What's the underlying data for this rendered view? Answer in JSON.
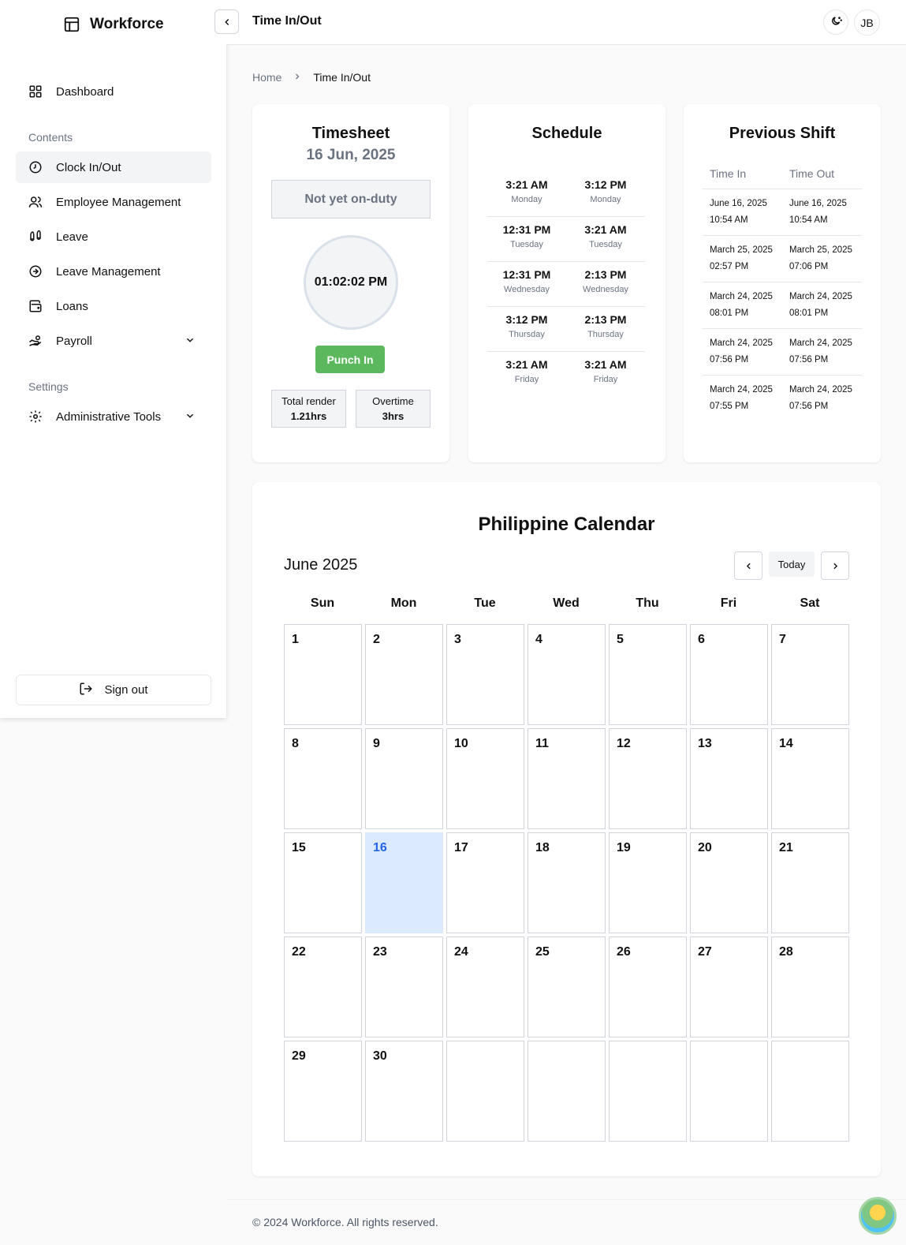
{
  "app": {
    "name": "Workforce"
  },
  "sidebar": {
    "sections": {
      "contents": "Contents",
      "settings": "Settings"
    },
    "items": [
      {
        "label": "Dashboard",
        "icon": "grid-icon"
      },
      {
        "label": "Clock In/Out",
        "icon": "clock-icon",
        "active": true
      },
      {
        "label": "Employee Management",
        "icon": "users-icon"
      },
      {
        "label": "Leave",
        "icon": "footprints-icon"
      },
      {
        "label": "Leave Management",
        "icon": "arrow-circle-icon"
      },
      {
        "label": "Loans",
        "icon": "wallet-icon"
      },
      {
        "label": "Payroll",
        "icon": "hand-coins-icon",
        "expandable": true
      },
      {
        "label": "Administrative Tools",
        "icon": "gear-icon",
        "expandable": true
      }
    ],
    "signout": "Sign out"
  },
  "header": {
    "title": "Time In/Out",
    "avatar": "JB"
  },
  "breadcrumb": {
    "home": "Home",
    "current": "Time In/Out"
  },
  "timesheet": {
    "title": "Timesheet",
    "date": "16 Jun, 2025",
    "status": "Not yet on-duty",
    "clock": "01:02:02 PM",
    "punch": "Punch In",
    "total_label": "Total render",
    "total_value": "1.21hrs",
    "overtime_label": "Overtime",
    "overtime_value": "3hrs"
  },
  "schedule": {
    "title": "Schedule",
    "rows": [
      {
        "in": "3:21 AM",
        "out": "3:12 PM",
        "day_in": "Monday",
        "day_out": "Monday"
      },
      {
        "in": "12:31 PM",
        "out": "3:21 AM",
        "day_in": "Tuesday",
        "day_out": "Tuesday"
      },
      {
        "in": "12:31 PM",
        "out": "2:13 PM",
        "day_in": "Wednesday",
        "day_out": "Wednesday"
      },
      {
        "in": "3:12 PM",
        "out": "2:13 PM",
        "day_in": "Thursday",
        "day_out": "Thursday"
      },
      {
        "in": "3:21 AM",
        "out": "3:21 AM",
        "day_in": "Friday",
        "day_out": "Friday"
      }
    ]
  },
  "previous_shift": {
    "title": "Previous Shift",
    "col_in": "Time In",
    "col_out": "Time Out",
    "rows": [
      {
        "in_date": "June 16, 2025",
        "in_time": "10:54 AM",
        "out_date": "June 16, 2025",
        "out_time": "10:54 AM"
      },
      {
        "in_date": "March 25, 2025",
        "in_time": "02:57 PM",
        "out_date": "March 25, 2025",
        "out_time": "07:06 PM"
      },
      {
        "in_date": "March 24, 2025",
        "in_time": "08:01 PM",
        "out_date": "March 24, 2025",
        "out_time": "08:01 PM"
      },
      {
        "in_date": "March 24, 2025",
        "in_time": "07:56 PM",
        "out_date": "March 24, 2025",
        "out_time": "07:56 PM"
      },
      {
        "in_date": "March 24, 2025",
        "in_time": "07:55 PM",
        "out_date": "March 24, 2025",
        "out_time": "07:56 PM"
      }
    ]
  },
  "calendar": {
    "title": "Philippine Calendar",
    "month": "June 2025",
    "today_label": "Today",
    "weekdays": [
      "Sun",
      "Mon",
      "Tue",
      "Wed",
      "Thu",
      "Fri",
      "Sat"
    ],
    "days": [
      "1",
      "2",
      "3",
      "4",
      "5",
      "6",
      "7",
      "8",
      "9",
      "10",
      "11",
      "12",
      "13",
      "14",
      "15",
      "16",
      "17",
      "18",
      "19",
      "20",
      "21",
      "22",
      "23",
      "24",
      "25",
      "26",
      "27",
      "28",
      "29",
      "30",
      "",
      "",
      "",
      "",
      ""
    ],
    "today": "16"
  },
  "footer": {
    "text": "© 2024 Workforce. All rights reserved."
  }
}
